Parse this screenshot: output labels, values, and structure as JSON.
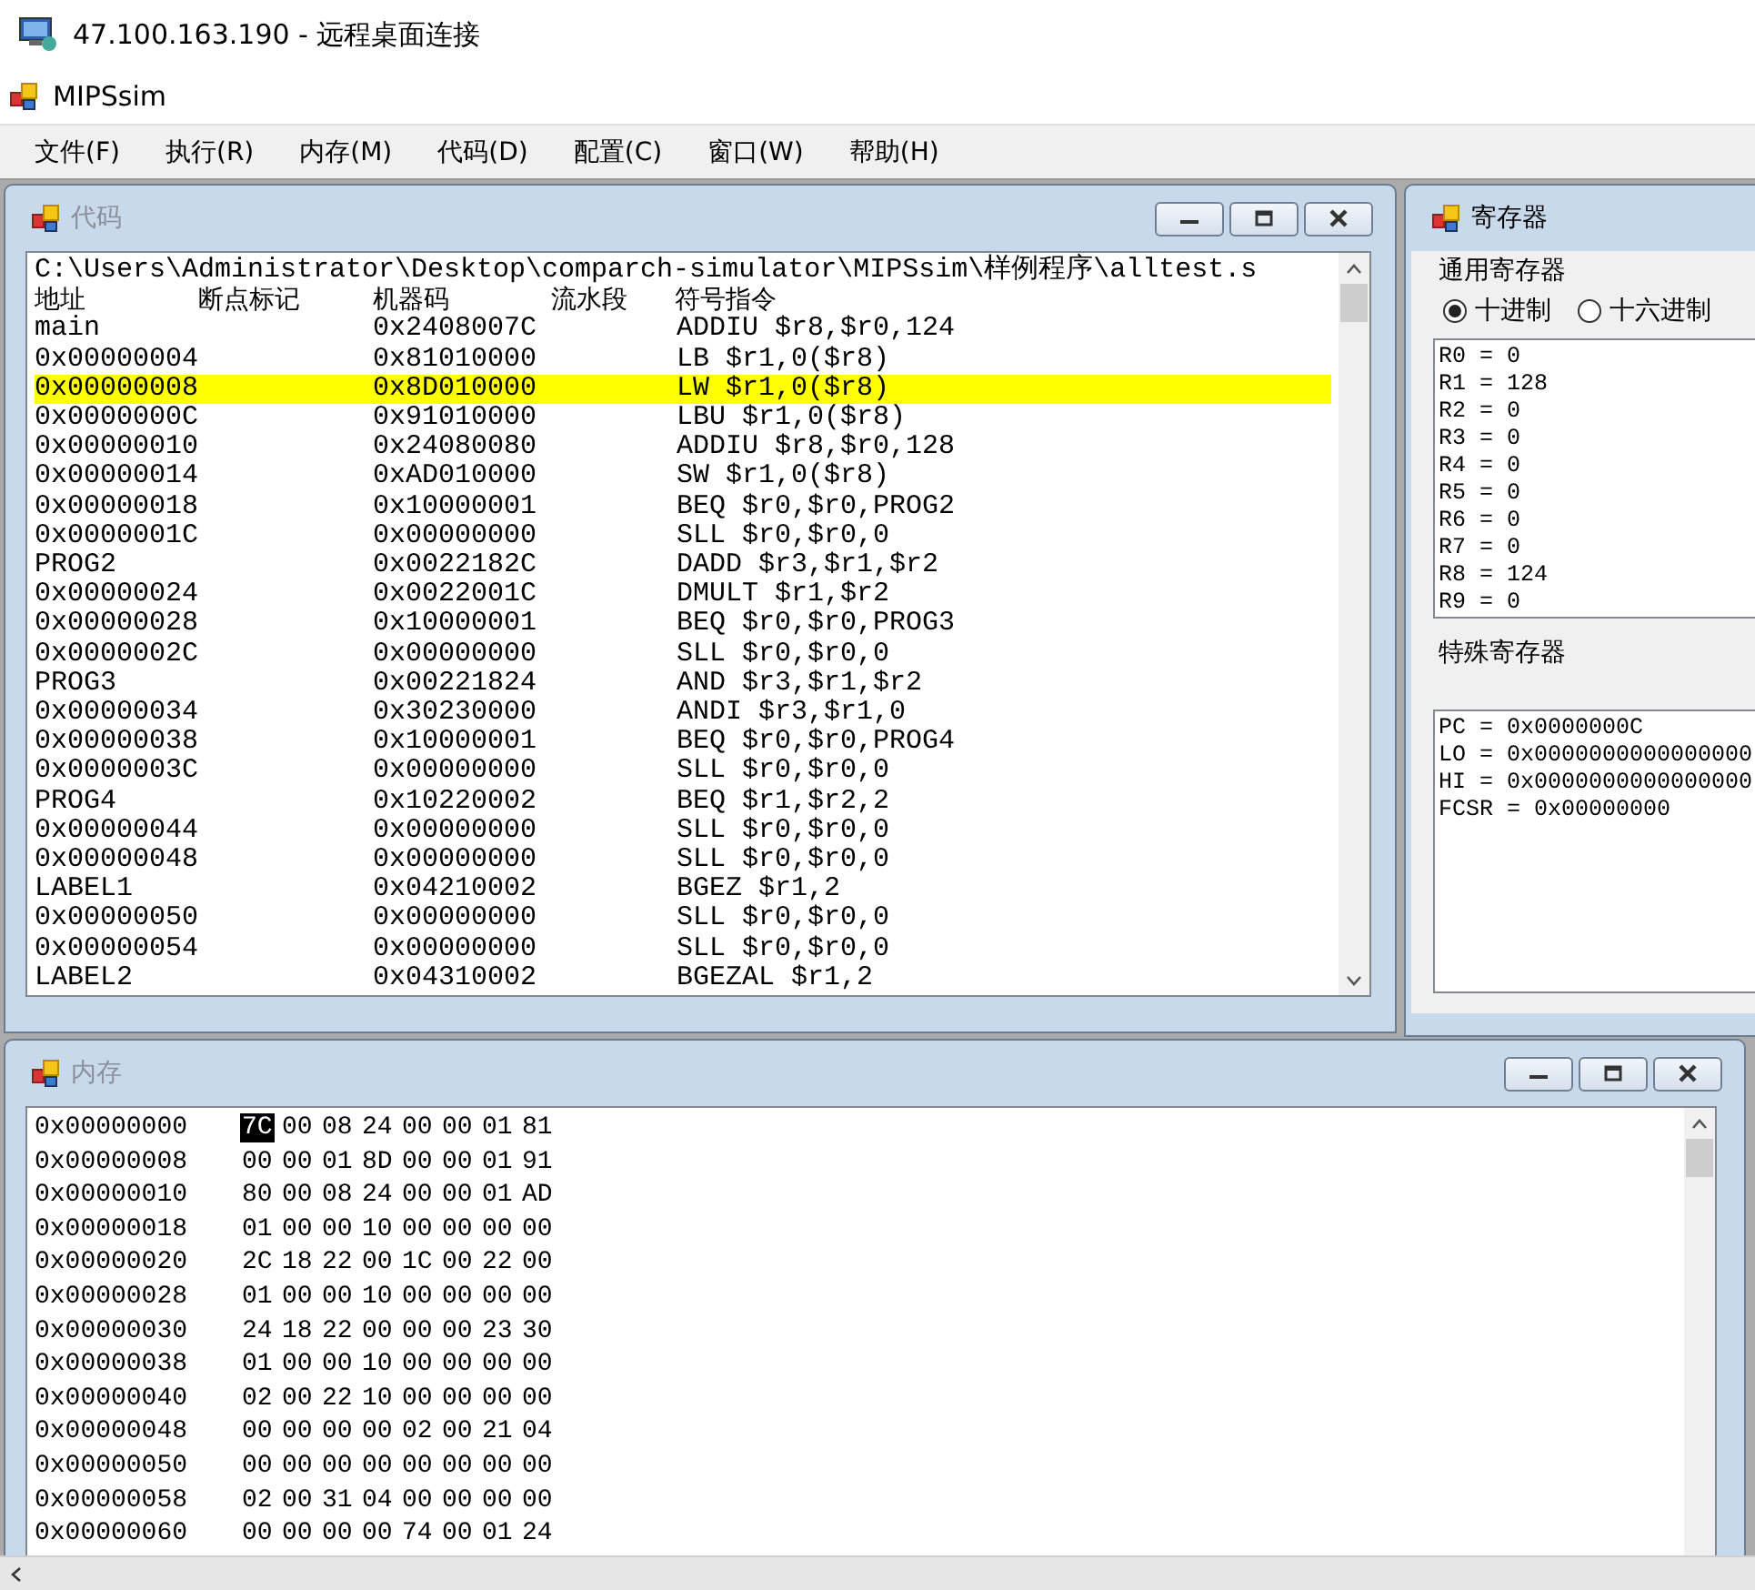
{
  "remote_window": {
    "title": "47.100.163.190 - 远程桌面连接"
  },
  "app": {
    "title": "MIPSsim"
  },
  "menu": [
    "文件(F)",
    "执行(R)",
    "内存(M)",
    "代码(D)",
    "配置(C)",
    "窗口(W)",
    "帮助(H)"
  ],
  "code_window": {
    "title": "代码",
    "path": "C:\\Users\\Administrator\\Desktop\\comparch-simulator\\MIPSsim\\样例程序\\alltest.s",
    "columns": [
      "地址",
      "断点标记",
      "机器码",
      "流水段",
      "符号指令"
    ],
    "rows": [
      {
        "address": "main",
        "machine_code": "0x2408007C",
        "instruction": "ADDIU $r8,$r0,124",
        "selected": false
      },
      {
        "address": "0x00000004",
        "machine_code": "0x81010000",
        "instruction": "LB $r1,0($r8)",
        "selected": false
      },
      {
        "address": "0x00000008",
        "machine_code": "0x8D010000",
        "instruction": "LW $r1,0($r8)",
        "selected": true
      },
      {
        "address": "0x0000000C",
        "machine_code": "0x91010000",
        "instruction": "LBU $r1,0($r8)",
        "selected": false
      },
      {
        "address": "0x00000010",
        "machine_code": "0x24080080",
        "instruction": "ADDIU $r8,$r0,128",
        "selected": false
      },
      {
        "address": "0x00000014",
        "machine_code": "0xAD010000",
        "instruction": "SW $r1,0($r8)",
        "selected": false
      },
      {
        "address": "0x00000018",
        "machine_code": "0x10000001",
        "instruction": "BEQ $r0,$r0,PROG2",
        "selected": false
      },
      {
        "address": "0x0000001C",
        "machine_code": "0x00000000",
        "instruction": "SLL $r0,$r0,0",
        "selected": false
      },
      {
        "address": "PROG2",
        "machine_code": "0x0022182C",
        "instruction": "DADD $r3,$r1,$r2",
        "selected": false
      },
      {
        "address": "0x00000024",
        "machine_code": "0x0022001C",
        "instruction": "DMULT $r1,$r2",
        "selected": false
      },
      {
        "address": "0x00000028",
        "machine_code": "0x10000001",
        "instruction": "BEQ $r0,$r0,PROG3",
        "selected": false
      },
      {
        "address": "0x0000002C",
        "machine_code": "0x00000000",
        "instruction": "SLL $r0,$r0,0",
        "selected": false
      },
      {
        "address": "PROG3",
        "machine_code": "0x00221824",
        "instruction": "AND $r3,$r1,$r2",
        "selected": false
      },
      {
        "address": "0x00000034",
        "machine_code": "0x30230000",
        "instruction": "ANDI $r3,$r1,0",
        "selected": false
      },
      {
        "address": "0x00000038",
        "machine_code": "0x10000001",
        "instruction": "BEQ $r0,$r0,PROG4",
        "selected": false
      },
      {
        "address": "0x0000003C",
        "machine_code": "0x00000000",
        "instruction": "SLL $r0,$r0,0",
        "selected": false
      },
      {
        "address": "PROG4",
        "machine_code": "0x10220002",
        "instruction": "BEQ $r1,$r2,2",
        "selected": false
      },
      {
        "address": "0x00000044",
        "machine_code": "0x00000000",
        "instruction": "SLL $r0,$r0,0",
        "selected": false
      },
      {
        "address": "0x00000048",
        "machine_code": "0x00000000",
        "instruction": "SLL $r0,$r0,0",
        "selected": false
      },
      {
        "address": "LABEL1",
        "machine_code": "0x04210002",
        "instruction": "BGEZ $r1,2",
        "selected": false
      },
      {
        "address": "0x00000050",
        "machine_code": "0x00000000",
        "instruction": "SLL $r0,$r0,0",
        "selected": false
      },
      {
        "address": "0x00000054",
        "machine_code": "0x00000000",
        "instruction": "SLL $r0,$r0,0",
        "selected": false
      },
      {
        "address": "LABEL2",
        "machine_code": "0x04310002",
        "instruction": "BGEZAL $r1,2",
        "selected": false
      }
    ]
  },
  "register_window": {
    "title": "寄存器",
    "general_label": "通用寄存器",
    "radios": [
      {
        "label": "十进制",
        "selected": true
      },
      {
        "label": "十六进制",
        "selected": false
      }
    ],
    "general": [
      "R0 = 0",
      "R1 = 128",
      "R2 = 0",
      "R3 = 0",
      "R4 = 0",
      "R5 = 0",
      "R6 = 0",
      "R7 = 0",
      "R8 = 124",
      "R9 = 0"
    ],
    "special_label": "特殊寄存器",
    "special": [
      "PC = 0x0000000C",
      "LO = 0x0000000000000000",
      "HI = 0x0000000000000000",
      "FCSR = 0x00000000"
    ]
  },
  "memory_window": {
    "title": "内存",
    "rows": [
      {
        "address": "0x00000000",
        "bytes": [
          {
            "value": "7C",
            "selected": true
          },
          {
            "value": "00",
            "selected": false
          },
          {
            "value": "08",
            "selected": false
          },
          {
            "value": "24",
            "selected": false
          },
          {
            "value": "00",
            "selected": false
          },
          {
            "value": "00",
            "selected": false
          },
          {
            "value": "01",
            "selected": false
          },
          {
            "value": "81",
            "selected": false
          }
        ]
      },
      {
        "address": "0x00000008",
        "bytes": [
          {
            "value": "00",
            "selected": false
          },
          {
            "value": "00",
            "selected": false
          },
          {
            "value": "01",
            "selected": false
          },
          {
            "value": "8D",
            "selected": false
          },
          {
            "value": "00",
            "selected": false
          },
          {
            "value": "00",
            "selected": false
          },
          {
            "value": "01",
            "selected": false
          },
          {
            "value": "91",
            "selected": false
          }
        ]
      },
      {
        "address": "0x00000010",
        "bytes": [
          {
            "value": "80",
            "selected": false
          },
          {
            "value": "00",
            "selected": false
          },
          {
            "value": "08",
            "selected": false
          },
          {
            "value": "24",
            "selected": false
          },
          {
            "value": "00",
            "selected": false
          },
          {
            "value": "00",
            "selected": false
          },
          {
            "value": "01",
            "selected": false
          },
          {
            "value": "AD",
            "selected": false
          }
        ]
      },
      {
        "address": "0x00000018",
        "bytes": [
          {
            "value": "01",
            "selected": false
          },
          {
            "value": "00",
            "selected": false
          },
          {
            "value": "00",
            "selected": false
          },
          {
            "value": "10",
            "selected": false
          },
          {
            "value": "00",
            "selected": false
          },
          {
            "value": "00",
            "selected": false
          },
          {
            "value": "00",
            "selected": false
          },
          {
            "value": "00",
            "selected": false
          }
        ]
      },
      {
        "address": "0x00000020",
        "bytes": [
          {
            "value": "2C",
            "selected": false
          },
          {
            "value": "18",
            "selected": false
          },
          {
            "value": "22",
            "selected": false
          },
          {
            "value": "00",
            "selected": false
          },
          {
            "value": "1C",
            "selected": false
          },
          {
            "value": "00",
            "selected": false
          },
          {
            "value": "22",
            "selected": false
          },
          {
            "value": "00",
            "selected": false
          }
        ]
      },
      {
        "address": "0x00000028",
        "bytes": [
          {
            "value": "01",
            "selected": false
          },
          {
            "value": "00",
            "selected": false
          },
          {
            "value": "00",
            "selected": false
          },
          {
            "value": "10",
            "selected": false
          },
          {
            "value": "00",
            "selected": false
          },
          {
            "value": "00",
            "selected": false
          },
          {
            "value": "00",
            "selected": false
          },
          {
            "value": "00",
            "selected": false
          }
        ]
      },
      {
        "address": "0x00000030",
        "bytes": [
          {
            "value": "24",
            "selected": false
          },
          {
            "value": "18",
            "selected": false
          },
          {
            "value": "22",
            "selected": false
          },
          {
            "value": "00",
            "selected": false
          },
          {
            "value": "00",
            "selected": false
          },
          {
            "value": "00",
            "selected": false
          },
          {
            "value": "23",
            "selected": false
          },
          {
            "value": "30",
            "selected": false
          }
        ]
      },
      {
        "address": "0x00000038",
        "bytes": [
          {
            "value": "01",
            "selected": false
          },
          {
            "value": "00",
            "selected": false
          },
          {
            "value": "00",
            "selected": false
          },
          {
            "value": "10",
            "selected": false
          },
          {
            "value": "00",
            "selected": false
          },
          {
            "value": "00",
            "selected": false
          },
          {
            "value": "00",
            "selected": false
          },
          {
            "value": "00",
            "selected": false
          }
        ]
      },
      {
        "address": "0x00000040",
        "bytes": [
          {
            "value": "02",
            "selected": false
          },
          {
            "value": "00",
            "selected": false
          },
          {
            "value": "22",
            "selected": false
          },
          {
            "value": "10",
            "selected": false
          },
          {
            "value": "00",
            "selected": false
          },
          {
            "value": "00",
            "selected": false
          },
          {
            "value": "00",
            "selected": false
          },
          {
            "value": "00",
            "selected": false
          }
        ]
      },
      {
        "address": "0x00000048",
        "bytes": [
          {
            "value": "00",
            "selected": false
          },
          {
            "value": "00",
            "selected": false
          },
          {
            "value": "00",
            "selected": false
          },
          {
            "value": "00",
            "selected": false
          },
          {
            "value": "02",
            "selected": false
          },
          {
            "value": "00",
            "selected": false
          },
          {
            "value": "21",
            "selected": false
          },
          {
            "value": "04",
            "selected": false
          }
        ]
      },
      {
        "address": "0x00000050",
        "bytes": [
          {
            "value": "00",
            "selected": false
          },
          {
            "value": "00",
            "selected": false
          },
          {
            "value": "00",
            "selected": false
          },
          {
            "value": "00",
            "selected": false
          },
          {
            "value": "00",
            "selected": false
          },
          {
            "value": "00",
            "selected": false
          },
          {
            "value": "00",
            "selected": false
          },
          {
            "value": "00",
            "selected": false
          }
        ]
      },
      {
        "address": "0x00000058",
        "bytes": [
          {
            "value": "02",
            "selected": false
          },
          {
            "value": "00",
            "selected": false
          },
          {
            "value": "31",
            "selected": false
          },
          {
            "value": "04",
            "selected": false
          },
          {
            "value": "00",
            "selected": false
          },
          {
            "value": "00",
            "selected": false
          },
          {
            "value": "00",
            "selected": false
          },
          {
            "value": "00",
            "selected": false
          }
        ]
      },
      {
        "address": "0x00000060",
        "bytes": [
          {
            "value": "00",
            "selected": false
          },
          {
            "value": "00",
            "selected": false
          },
          {
            "value": "00",
            "selected": false
          },
          {
            "value": "00",
            "selected": false
          },
          {
            "value": "74",
            "selected": false
          },
          {
            "value": "00",
            "selected": false
          },
          {
            "value": "01",
            "selected": false
          },
          {
            "value": "24",
            "selected": false
          }
        ]
      }
    ]
  }
}
